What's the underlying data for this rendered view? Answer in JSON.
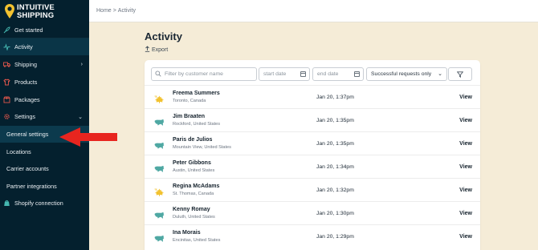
{
  "brand": {
    "line1": "INTUITIVE",
    "line2": "SHIPPING"
  },
  "sidebar": {
    "items": [
      {
        "label": "Get started",
        "icon": "rocket-icon"
      },
      {
        "label": "Activity",
        "icon": "activity-icon"
      },
      {
        "label": "Shipping",
        "icon": "truck-icon",
        "chevron": "›"
      },
      {
        "label": "Products",
        "icon": "shirt-icon"
      },
      {
        "label": "Packages",
        "icon": "package-icon"
      },
      {
        "label": "Settings",
        "icon": "gear-icon",
        "chevron": "⌄"
      },
      {
        "label": "General settings"
      },
      {
        "label": "Locations"
      },
      {
        "label": "Carrier accounts"
      },
      {
        "label": "Partner integrations"
      },
      {
        "label": "Shopify connection",
        "icon": "shopify-icon"
      }
    ]
  },
  "breadcrumb": {
    "home": "Home",
    "separator": ">",
    "current": "Activity"
  },
  "page": {
    "title": "Activity",
    "export_label": "Export"
  },
  "filters": {
    "search_placeholder": "Filter by customer name",
    "start_date_placeholder": "start date",
    "end_date_placeholder": "end date",
    "status_selected": "Successful requests only"
  },
  "rows": [
    {
      "flag": "canada",
      "name": "Freema Summers",
      "location": "Toronto, Canada",
      "date": "Jan 20, 1:37pm",
      "action": "View"
    },
    {
      "flag": "usa",
      "name": "Jim Braaten",
      "location": "Rockford, United States",
      "date": "Jan 20, 1:35pm",
      "action": "View"
    },
    {
      "flag": "usa",
      "name": "Paris de Julios",
      "location": "Mountain View, United States",
      "date": "Jan 20, 1:35pm",
      "action": "View"
    },
    {
      "flag": "usa",
      "name": "Peter Gibbons",
      "location": "Austin, United States",
      "date": "Jan 20, 1:34pm",
      "action": "View"
    },
    {
      "flag": "canada",
      "name": "Regina McAdams",
      "location": "St. Thomas, Canada",
      "date": "Jan 20, 1:32pm",
      "action": "View"
    },
    {
      "flag": "usa",
      "name": "Kenny Romay",
      "location": "Duluth, United States",
      "date": "Jan 20, 1:30pm",
      "action": "View"
    },
    {
      "flag": "usa",
      "name": "Ina Morais",
      "location": "Encinitas, United States",
      "date": "Jan 20, 1:29pm",
      "action": "View"
    }
  ],
  "colors": {
    "sidebar": "#04202e",
    "background": "#f5ecd7",
    "accent_yellow": "#f2c230",
    "usa_teal": "#4fa8a3",
    "arrow_red": "#e8251f"
  }
}
